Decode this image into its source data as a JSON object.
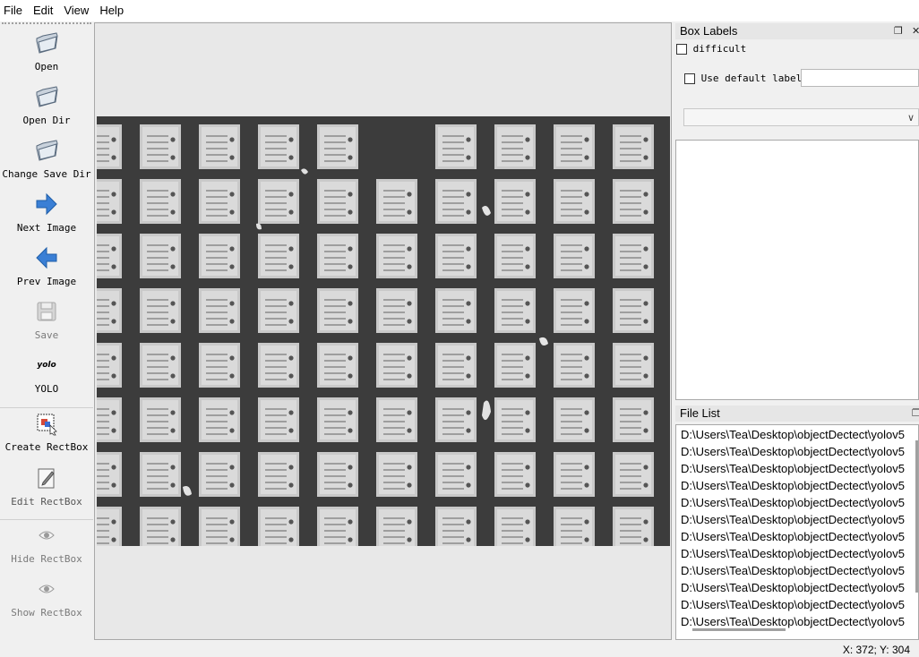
{
  "menu": [
    "File",
    "Edit",
    "View",
    "Help"
  ],
  "toolbar": {
    "open": "Open",
    "open_dir": "Open Dir",
    "change_save_dir": "Change Save Dir",
    "next_image": "Next Image",
    "prev_image": "Prev Image",
    "save": "Save",
    "yolo_badge": "yolo",
    "yolo": "YOLO",
    "create_rectbox": "Create RectBox",
    "edit_rectbox": "Edit RectBox",
    "hide_rectbox": "Hide RectBox",
    "show_rectbox": "Show RectBox"
  },
  "box_labels": {
    "title": "Box Labels",
    "difficult": "difficult",
    "use_default_label": "Use default label",
    "default_label_value": "",
    "selected_label": ""
  },
  "file_list": {
    "title": "File List",
    "items": [
      "D:\\Users\\Tea\\Desktop\\objectDectect\\yolov5",
      "D:\\Users\\Tea\\Desktop\\objectDectect\\yolov5",
      "D:\\Users\\Tea\\Desktop\\objectDectect\\yolov5",
      "D:\\Users\\Tea\\Desktop\\objectDectect\\yolov5",
      "D:\\Users\\Tea\\Desktop\\objectDectect\\yolov5",
      "D:\\Users\\Tea\\Desktop\\objectDectect\\yolov5",
      "D:\\Users\\Tea\\Desktop\\objectDectect\\yolov5",
      "D:\\Users\\Tea\\Desktop\\objectDectect\\yolov5",
      "D:\\Users\\Tea\\Desktop\\objectDectect\\yolov5",
      "D:\\Users\\Tea\\Desktop\\objectDectect\\yolov5",
      "D:\\Users\\Tea\\Desktop\\objectDectect\\yolov5",
      "D:\\Users\\Tea\\Desktop\\objectDectect\\yolov5"
    ]
  },
  "status": {
    "coords": "X: 372; Y: 304"
  },
  "colors": {
    "accent_arrow": "#3a7fd5",
    "panel_bg": "#f0f0f0",
    "canvas_bg": "#e8e8e8"
  }
}
